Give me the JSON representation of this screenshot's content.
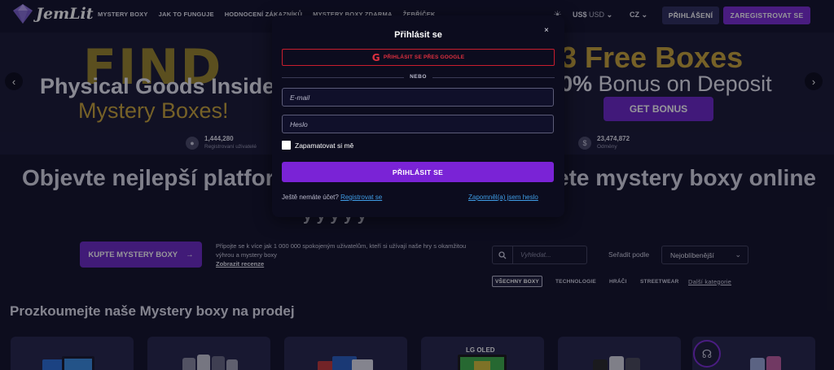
{
  "header": {
    "logo": "JemLit",
    "nav": [
      "MYSTERY BOXY",
      "JAK TO FUNGUJE",
      "HODNOCENÍ ZÁKAZNÍKŮ",
      "MYSTERY BOXY ZDARMA",
      "ŽEBŘÍČEK"
    ],
    "currency_code": "US$",
    "currency_name": "USD",
    "language": "CZ",
    "login_label": "PŘIHLÁŠENÍ",
    "register_label": "ZAREGISTROVAT SE"
  },
  "hero": {
    "find": "FIND",
    "line1": "Physical Goods Inside",
    "line2": "Mystery Boxes!",
    "right_line1": "3 Free Boxes",
    "right_line2_bold": "0%",
    "right_line2": " Bonus on Deposit",
    "bonus_button": "GET BONUS"
  },
  "stats": [
    {
      "value": "1,444,280",
      "label": "Registrovaní uživatelé",
      "icon": "user-icon"
    },
    {
      "value": "23,474,872",
      "label": "Odměny",
      "icon": "dollar-icon"
    }
  ],
  "headline": {
    "left": "Objevte nejlepší platfor",
    "right": "ete mystery boxy online",
    "line2": "y  y  y  y  y"
  },
  "cta": {
    "buy_button": "KUPTE MYSTERY BOXY",
    "join_text": "Připojte se k více jak 1 000 000 spokojeným uživatelům, kteří si užívají naše hry s okamžitou výhrou a mystery boxy",
    "reviews_link": "Zobrazit recenze"
  },
  "filters": {
    "search_placeholder": "Vyhledat...",
    "sort_label": "Seřadit podle",
    "sort_value": "Nejoblíbenější",
    "categories": [
      "VŠECHNY BOXY",
      "TECHNOLOGIE",
      "HRÁČI",
      "STREETWEAR"
    ],
    "more_categories": "Další kategorie"
  },
  "section": {
    "title": "Prozkoumejte naše Mystery boxy na prodej",
    "card_tag": "LG OLED"
  },
  "modal": {
    "title": "Přihlásit se",
    "close": "×",
    "google_label": "PŘIHLÁSIT SE PŘES GOOGLE",
    "divider": "NEBO",
    "email_placeholder": "E-mail",
    "password_placeholder": "Heslo",
    "remember_label": "Zapamatovat si mě",
    "submit_label": "PŘIHLÁSIT SE",
    "no_account_text": "Ještě nemáte účet?",
    "register_link": "Registrovat se",
    "forgot_link": "Zapomněl(a) jsem heslo"
  },
  "colors": {
    "background": "#14142a",
    "accent_purple": "#7a23d6",
    "google_red": "#e0303f",
    "link_blue": "#3f9de6",
    "gold": "#c9a43a"
  }
}
